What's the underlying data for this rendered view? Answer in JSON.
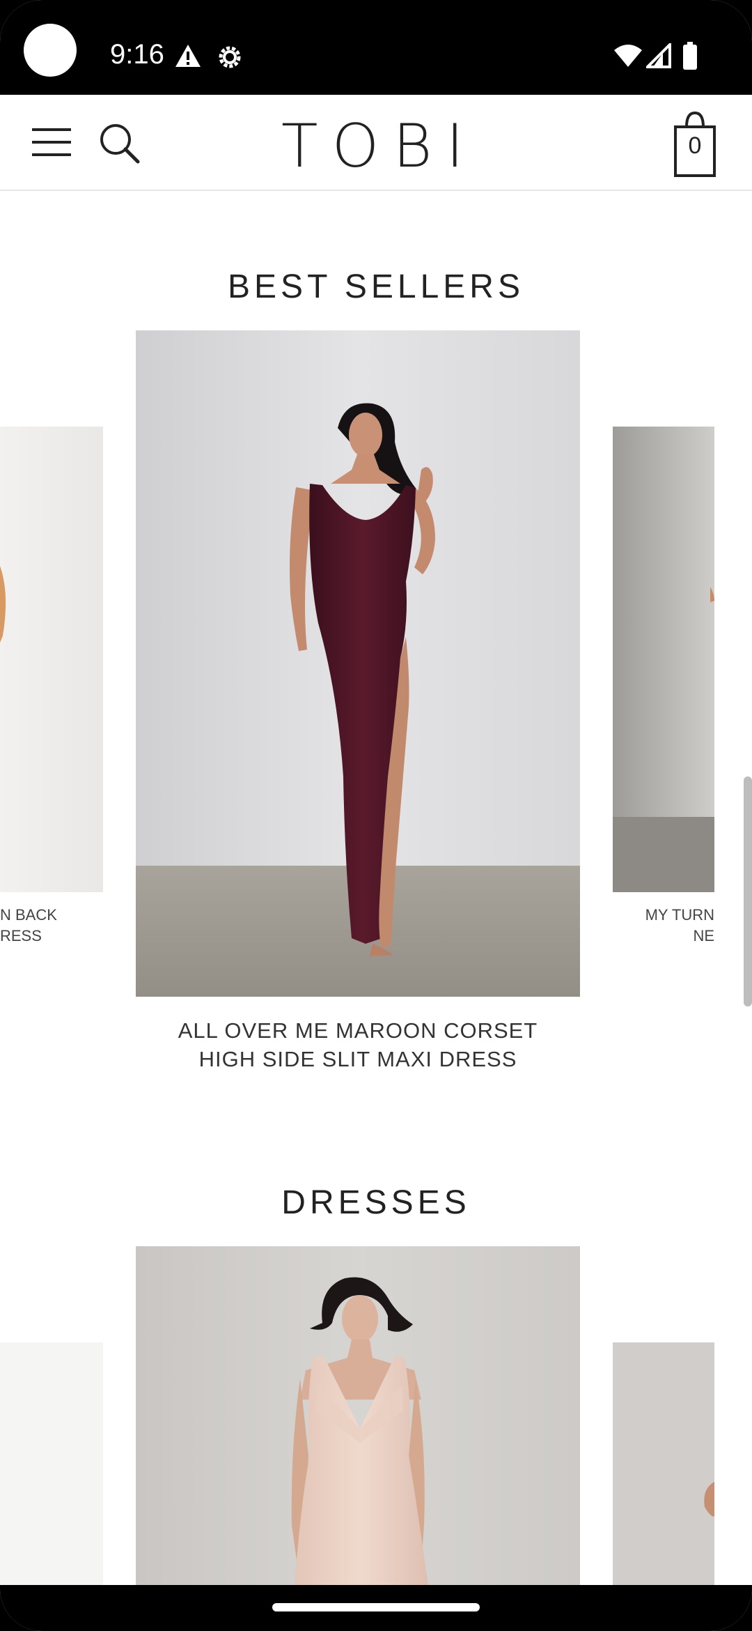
{
  "status_bar": {
    "time": "9:16",
    "icons": [
      "alert-icon",
      "settings-icon",
      "wifi-icon",
      "signal-icon",
      "battery-icon"
    ]
  },
  "header": {
    "logo": "TOBI",
    "cart_count": "0",
    "icons": [
      "menu-icon",
      "search-icon",
      "shopping-bag-icon"
    ]
  },
  "best_sellers": {
    "title": "BEST SELLERS",
    "left_caption_line1": "N BACK",
    "left_caption_line2": "RESS",
    "main_caption_line1": "ALL OVER ME MAROON CORSET",
    "main_caption_line2": "HIGH SIDE SLIT MAXI DRESS",
    "right_caption_line1": "MY TURN",
    "right_caption_line2": "NE"
  },
  "dresses": {
    "title": "DRESSES"
  },
  "colors": {
    "maroon": "#4a1324",
    "background": "#ffffff",
    "text": "#222222"
  }
}
